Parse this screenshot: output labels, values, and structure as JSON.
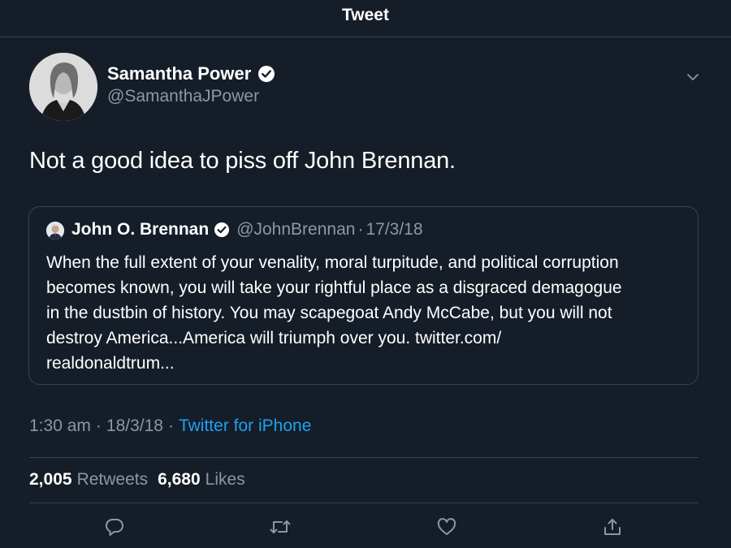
{
  "header": {
    "title": "Tweet"
  },
  "author": {
    "name": "Samantha Power",
    "handle": "@SamanthaJPower",
    "avatar_icon": "avatar-photo",
    "verified_icon": "verified-badge-icon"
  },
  "tweet": {
    "text": "Not a good idea to piss off John Brennan."
  },
  "quoted": {
    "name": "John O. Brennan",
    "handle": "@JohnBrennan",
    "separator": "·",
    "date": "17/3/18",
    "lines": [
      "When the full extent of your venality, moral turpitude, and political corruption",
      "becomes known, you will take your rightful place as a disgraced demagogue",
      "in the dustbin of history. You may scapegoat Andy McCabe, but you will  not",
      "destroy America...America will triumph over you. twitter.com/",
      "realdonaldtrum..."
    ]
  },
  "meta": {
    "time": "1:30 am",
    "separator": "·",
    "date": "18/3/18",
    "separator2": "·",
    "source": "Twitter for iPhone"
  },
  "stats": {
    "retweets_count": "2,005",
    "retweets_label": "Retweets",
    "likes_count": "6,680",
    "likes_label": "Likes"
  },
  "actions": [
    "reply-icon",
    "retweet-icon",
    "like-icon",
    "share-icon"
  ],
  "colors": {
    "background": "#151d28",
    "text": "#ffffff",
    "secondary": "#8899a6",
    "link": "#1da1f2",
    "border": "#38444d"
  }
}
